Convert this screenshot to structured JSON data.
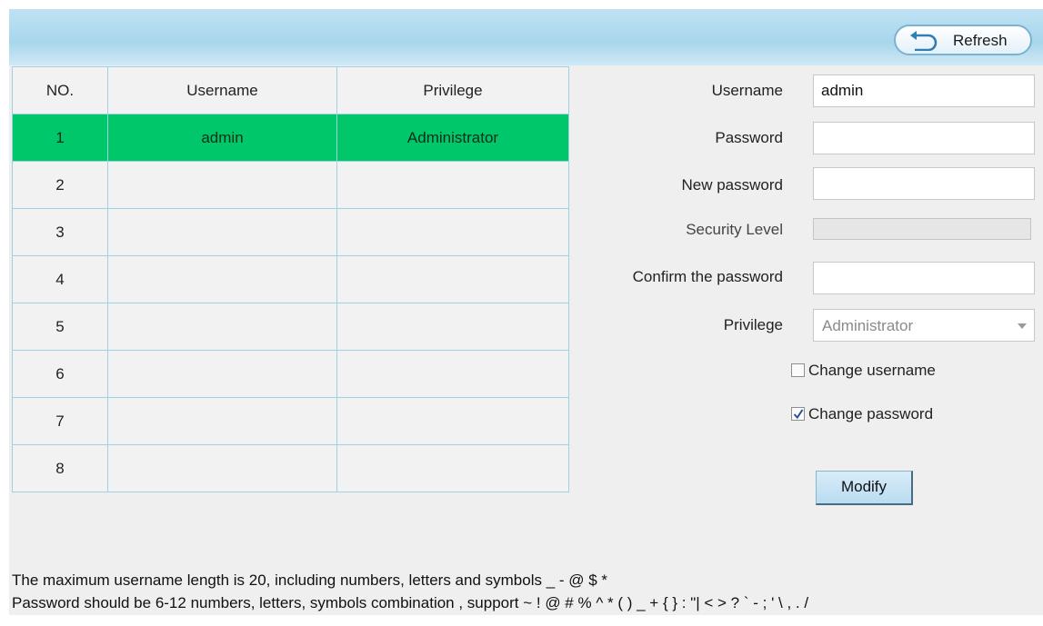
{
  "toolbar": {
    "refresh_label": "Refresh",
    "refresh_icon": "undo-arrow-icon"
  },
  "table": {
    "headers": [
      "NO.",
      "Username",
      "Privilege"
    ],
    "rows": [
      {
        "no": "1",
        "username": "admin",
        "privilege": "Administrator",
        "selected": true
      },
      {
        "no": "2",
        "username": "",
        "privilege": ""
      },
      {
        "no": "3",
        "username": "",
        "privilege": ""
      },
      {
        "no": "4",
        "username": "",
        "privilege": ""
      },
      {
        "no": "5",
        "username": "",
        "privilege": ""
      },
      {
        "no": "6",
        "username": "",
        "privilege": ""
      },
      {
        "no": "7",
        "username": "",
        "privilege": ""
      },
      {
        "no": "8",
        "username": "",
        "privilege": ""
      }
    ],
    "selected_color": "#00c76a"
  },
  "form": {
    "username_label": "Username",
    "username_value": "admin",
    "password_label": "Password",
    "password_value": "",
    "new_password_label": "New password",
    "new_password_value": "",
    "security_level_label": "Security Level",
    "security_level": 0,
    "confirm_label": "Confirm the password",
    "confirm_value": "",
    "privilege_label": "Privilege",
    "privilege_value": "Administrator",
    "change_username_label": "Change username",
    "change_username_checked": false,
    "change_password_label": "Change password",
    "change_password_checked": true,
    "modify_label": "Modify"
  },
  "notes": {
    "line1": "The maximum username length is 20, including numbers, letters and symbols _ - @ $ *",
    "line2": "Password should be 6-12 numbers, letters, symbols combination , support ~ ! @ # % ^ * ( ) _ + { } : \"| < > ? ` - ; ' \\ , . /"
  },
  "colors": {
    "header_bar": "#a9d6ec",
    "panel_bg": "#efefef",
    "table_border": "#9fd0e4"
  }
}
